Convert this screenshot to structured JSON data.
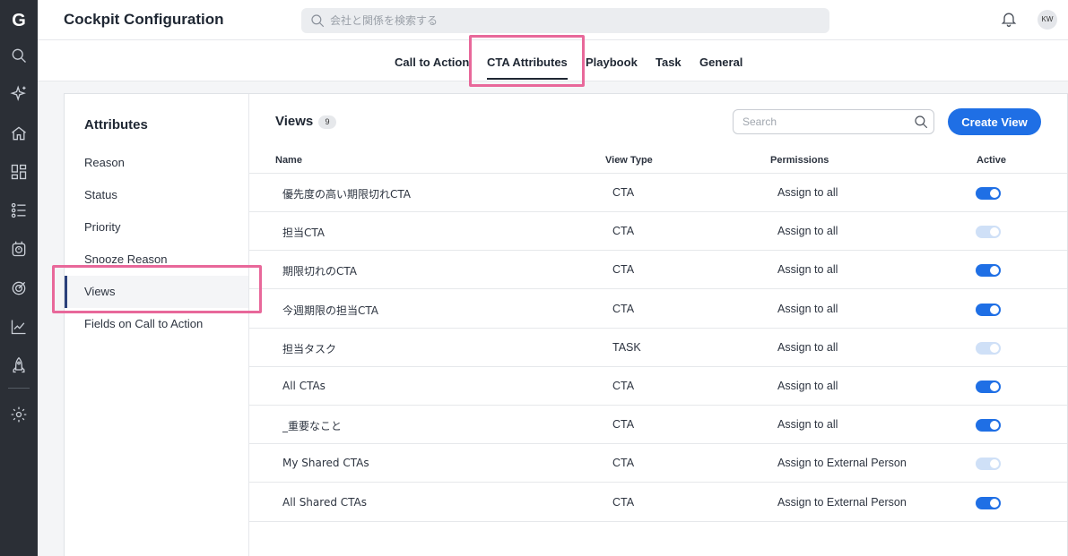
{
  "app": {
    "title": "Cockpit Configuration",
    "logo_letter": "G",
    "avatar_initials": "KW"
  },
  "global_search": {
    "placeholder": "会社と関係を検索する"
  },
  "rail": {
    "icons": [
      "search-icon",
      "sparkle-icon",
      "home-icon",
      "dashboard-icon",
      "timeline-icon",
      "cockpit-icon",
      "target-icon",
      "analytics-icon",
      "rocket-icon",
      "gear-icon"
    ]
  },
  "tabs": [
    {
      "label": "Call to Action",
      "active": false
    },
    {
      "label": "CTA Attributes",
      "active": true
    },
    {
      "label": "Playbook",
      "active": false
    },
    {
      "label": "Task",
      "active": false
    },
    {
      "label": "General",
      "active": false
    }
  ],
  "sidebar": {
    "title": "Attributes",
    "items": [
      {
        "label": "Reason"
      },
      {
        "label": "Status"
      },
      {
        "label": "Priority"
      },
      {
        "label": "Snooze Reason"
      },
      {
        "label": "Views",
        "active": true
      },
      {
        "label": "Fields on Call to Action"
      }
    ]
  },
  "views": {
    "title": "Views",
    "count": "9",
    "search_placeholder": "Search",
    "create_label": "Create View",
    "columns": {
      "name": "Name",
      "view_type": "View Type",
      "permissions": "Permissions",
      "active": "Active"
    },
    "rows": [
      {
        "name": "優先度の高い期限切れCTA",
        "view_type": "CTA",
        "permissions": "Assign to all",
        "active": true
      },
      {
        "name": "担当CTA",
        "view_type": "CTA",
        "permissions": "Assign to all",
        "active": false
      },
      {
        "name": "期限切れのCTA",
        "view_type": "CTA",
        "permissions": "Assign to all",
        "active": true
      },
      {
        "name": "今週期限の担当CTA",
        "view_type": "CTA",
        "permissions": "Assign to all",
        "active": true
      },
      {
        "name": "担当タスク",
        "view_type": "TASK",
        "permissions": "Assign to all",
        "active": false
      },
      {
        "name": "All CTAs",
        "view_type": "CTA",
        "permissions": "Assign to all",
        "active": true
      },
      {
        "name": "_重要なこと",
        "view_type": "CTA",
        "permissions": "Assign to all",
        "active": true
      },
      {
        "name": "My Shared CTAs",
        "view_type": "CTA",
        "permissions": "Assign to External Person",
        "active": false
      },
      {
        "name": "All Shared CTAs",
        "view_type": "CTA",
        "permissions": "Assign to External Person",
        "active": true
      }
    ]
  },
  "colors": {
    "accent": "#1f6fe5",
    "highlight": "#e8689a",
    "rail": "#2b2f36"
  }
}
